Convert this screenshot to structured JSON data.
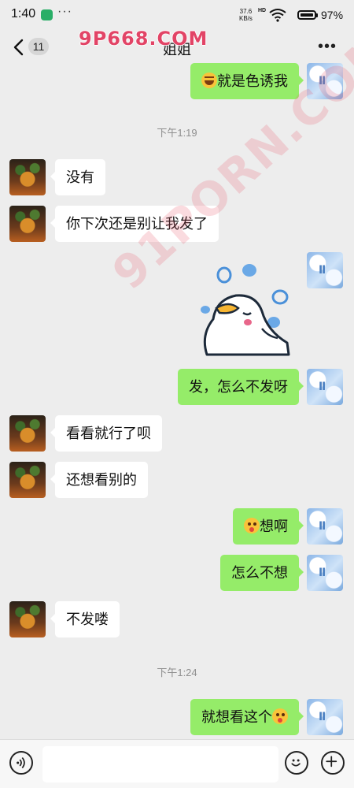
{
  "status_bar": {
    "time": "1:40",
    "net_speed_value": "37.6",
    "net_speed_unit": "KB/s",
    "hd_label": "HD",
    "battery_text": "97%",
    "battery_level": 0.97,
    "icons": [
      "wechat-icon",
      "more-dots-icon",
      "wifi-icon",
      "battery-icon"
    ]
  },
  "nav": {
    "unread_count": "11",
    "title": "姐姐"
  },
  "watermarks": {
    "top": "9P668.COM",
    "diagonal": "91PORN.COM"
  },
  "messages": [
    {
      "side": "out",
      "text": "就是色诱我",
      "emoji": "lol",
      "emoji_position": "before"
    },
    {
      "type": "time",
      "text": "下午1:19"
    },
    {
      "side": "in",
      "text": "没有"
    },
    {
      "side": "in",
      "text": "你下次还是别让我发了"
    },
    {
      "side": "out",
      "type": "sticker",
      "sticker": "crying-duck-sticker"
    },
    {
      "side": "out",
      "text": "发，怎么不发呀"
    },
    {
      "side": "in",
      "text": "看看就行了呗"
    },
    {
      "side": "in",
      "text": "还想看别的"
    },
    {
      "side": "out",
      "text": "想啊",
      "emoji": "drool",
      "emoji_position": "before"
    },
    {
      "side": "out",
      "text": "怎么不想"
    },
    {
      "side": "in",
      "text": "不发喽"
    },
    {
      "type": "time",
      "text": "下午1:24"
    },
    {
      "side": "out",
      "text": "就想看这个",
      "emoji": "drool",
      "emoji_position": "after"
    }
  ],
  "input_bar": {
    "value": "",
    "icons": [
      "voice-icon",
      "emoji-icon",
      "plus-icon"
    ]
  },
  "colors": {
    "background": "#ededed",
    "bubble_out": "#95ec69",
    "bubble_in": "#ffffff",
    "watermark": "#e24466"
  }
}
